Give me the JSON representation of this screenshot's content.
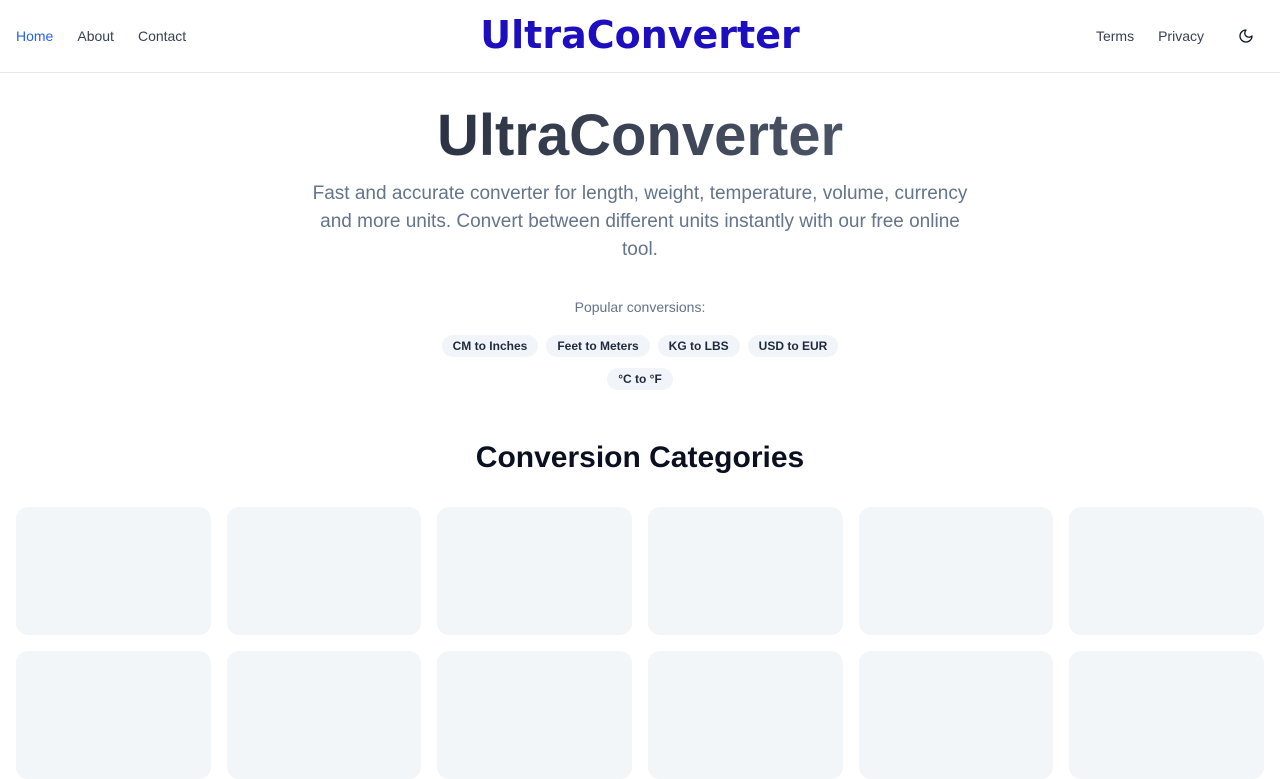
{
  "header": {
    "logo": "UltraConverter",
    "nav_left": [
      "Home",
      "About",
      "Contact"
    ],
    "nav_right": [
      "Terms",
      "Privacy"
    ],
    "theme_icon": "moon-icon",
    "active_color": "#2563eb",
    "logo_color": "#1d0fbf"
  },
  "hero": {
    "title": "UltraConverter",
    "subtitle": "Fast and accurate converter for length, weight, temperature, volume, currency and more units. Convert between different units instantly with our free online tool."
  },
  "popular": {
    "label": "Popular conversions:",
    "chips": [
      "CM to Inches",
      "Feet to Meters",
      "KG to LBS",
      "USD to EUR",
      "°C to °F"
    ]
  },
  "categories": {
    "title": "Conversion Categories",
    "card_count": 12
  }
}
